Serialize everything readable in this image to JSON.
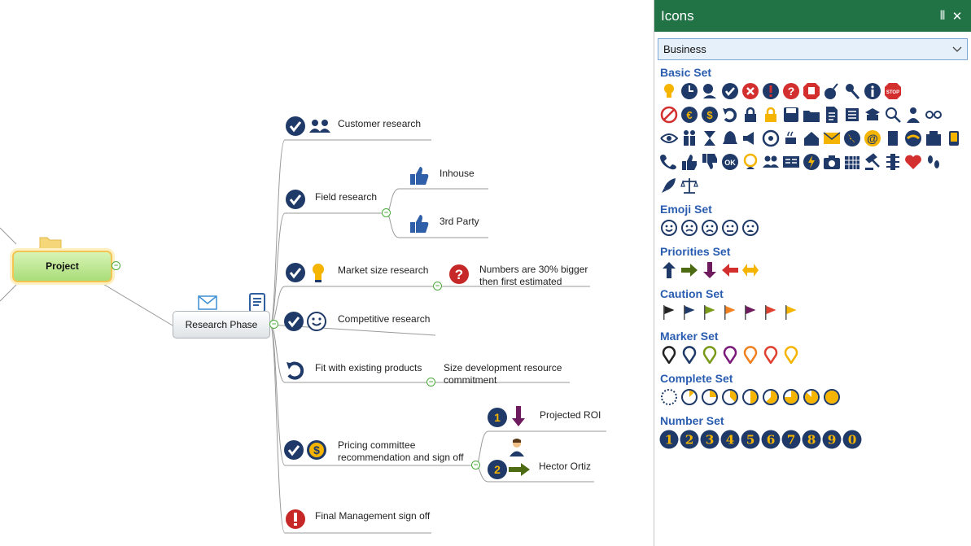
{
  "panel": {
    "title": "Icons",
    "pin_label": "⫴",
    "close_label": "✕",
    "dropdown": {
      "value": "Business"
    },
    "sets": [
      {
        "title": "Basic Set"
      },
      {
        "title": "Emoji Set"
      },
      {
        "title": "Priorities Set"
      },
      {
        "title": "Caution Set"
      },
      {
        "title": "Marker Set"
      },
      {
        "title": "Complete Set"
      },
      {
        "title": "Number Set"
      }
    ],
    "numbers": [
      "1",
      "2",
      "3",
      "4",
      "5",
      "6",
      "7",
      "8",
      "9",
      "0"
    ]
  },
  "map": {
    "central": "Project",
    "subtopic": "Research Phase",
    "topics": {
      "customer": "Customer research",
      "field": "Field research",
      "inhouse": "Inhouse",
      "third_party": "3rd Party",
      "market": "Market size research",
      "numbers_1": "Numbers are 30% bigger",
      "numbers_2": "then first estimated",
      "competitive": "Competitive research",
      "fit": "Fit with existing products",
      "size_1": "Size development resource",
      "size_2": "commitment",
      "pricing_1": "Pricing committee",
      "pricing_2": "recommendation and sign off",
      "roi": "Projected ROI",
      "hector": "Hector Ortiz",
      "final": "Final Management sign off"
    },
    "number_badges": [
      "1",
      "2"
    ]
  },
  "colors": {
    "panel_header": "#217346",
    "icon_navy": "#1f3a68",
    "link_blue": "#2a5db0",
    "green_node": "#a9dd79"
  }
}
